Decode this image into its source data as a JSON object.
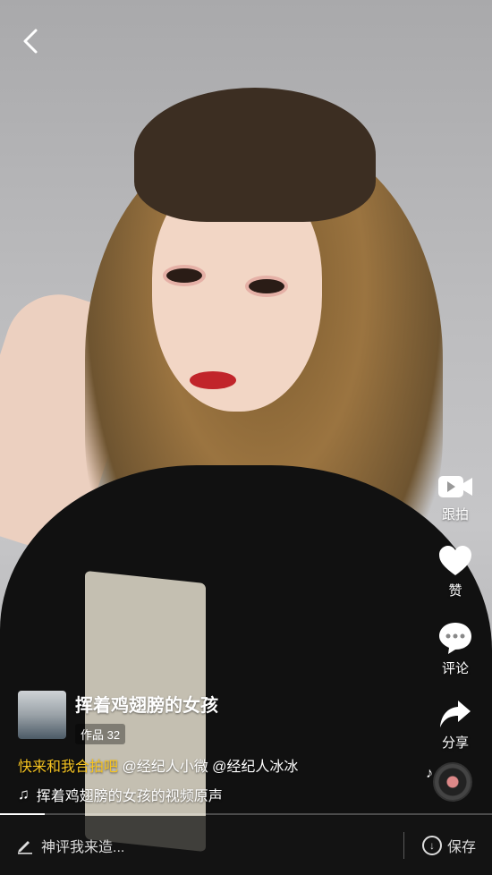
{
  "video": {
    "author_title": "挥着鸡翅膀的女孩",
    "works_badge": "作品 32",
    "description": {
      "highlight": "快来和我合拍吧",
      "mentions": " @经纪人小微 @经纪人冰冰"
    },
    "music": "挥着鸡翅膀的女孩的视频原声",
    "progress_fraction": 0.09
  },
  "actions": {
    "duet": "跟拍",
    "like": "赞",
    "comment": "评论",
    "share": "分享"
  },
  "bottom_bar": {
    "comment_placeholder": "神评我来造...",
    "save_label": "保存"
  },
  "icons": {
    "back": "chevron-left-icon",
    "duet": "video-camera-icon",
    "like": "heart-icon",
    "comment": "speech-bubble-icon",
    "share": "share-arrow-icon",
    "music": "music-note-icon",
    "pencil": "pencil-icon",
    "save": "download-icon"
  },
  "colors": {
    "highlight": "#f5c320"
  }
}
